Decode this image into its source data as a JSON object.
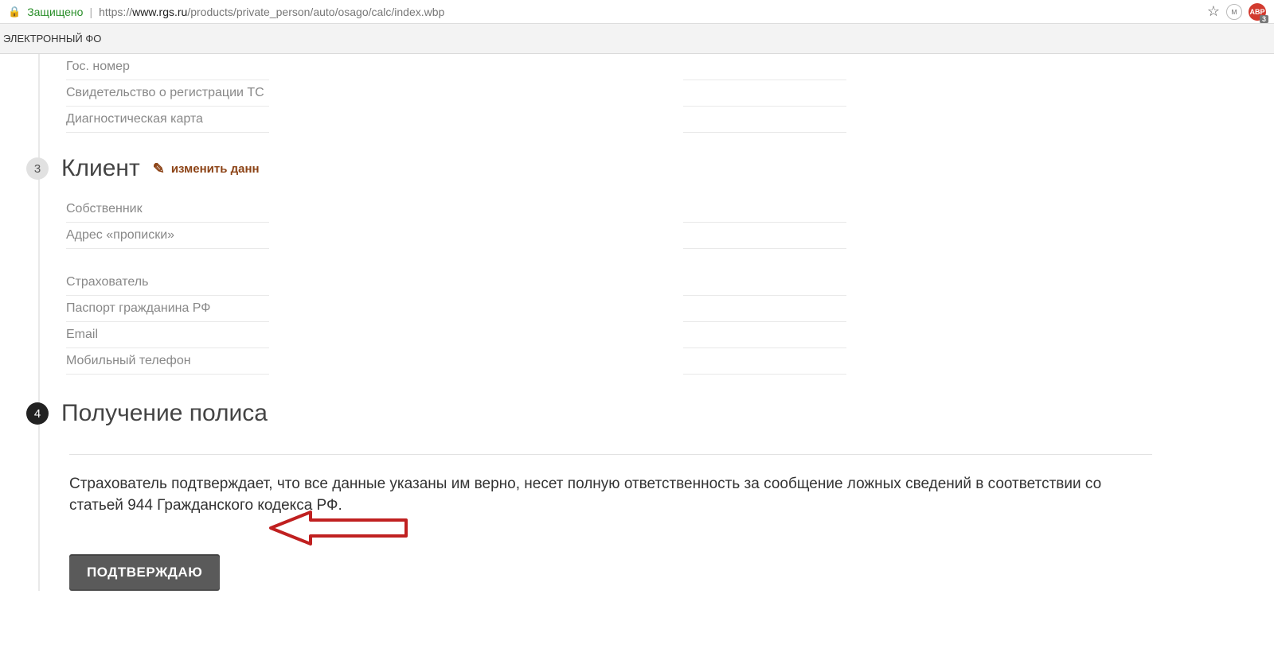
{
  "browser": {
    "secure_label": "Защищено",
    "url_prefix": "https://",
    "url_host": "www.rgs.ru",
    "url_path": "/products/private_person/auto/osago/calc/index.wbp",
    "abp_counter": "3"
  },
  "bookmarks_bar": {
    "item1": "ЭЛЕКТРОННЫЙ ФО"
  },
  "vehicle_fields": {
    "gos_number": "Гос. номер",
    "certificate": "Свидетельство о регистрации ТС",
    "diag_card": "Диагностическая карта"
  },
  "section3": {
    "number": "3",
    "title": "Клиент",
    "edit_label": "изменить данн"
  },
  "client_fields": {
    "owner": "Собственник",
    "address": "Адрес «прописки»",
    "insurer": "Страхователь",
    "passport": "Паспорт гражданина РФ",
    "email": "Email",
    "mobile": "Мобильный телефон"
  },
  "section4": {
    "number": "4",
    "title": "Получение полиса"
  },
  "policy": {
    "disclaimer": "Страхователь подтверждает, что все данные указаны им верно, несет полную ответственность за сообщение ложных сведений в соответствии со статьей 944 Гражданского кодекса РФ.",
    "confirm_button": "ПОДТВЕРЖДАЮ"
  }
}
